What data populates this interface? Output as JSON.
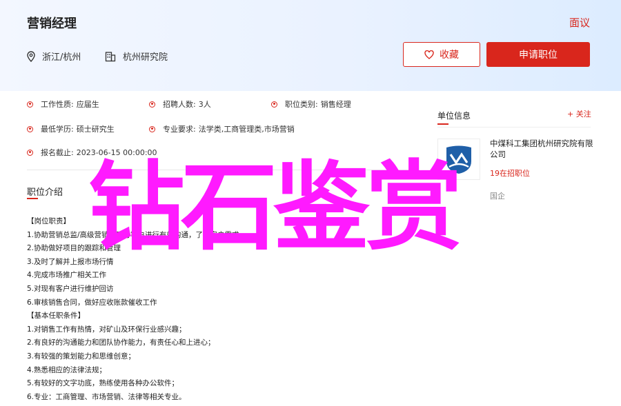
{
  "header": {
    "job_title": "营销经理",
    "negotiable": "面议",
    "location": "浙江/杭州",
    "organization": "杭州研究院",
    "favorite_label": "收藏",
    "apply_label": "申请职位"
  },
  "info": {
    "job_type_label": "工作性质:",
    "job_type_value": "应届生",
    "headcount_label": "招聘人数:",
    "headcount_value": "3人",
    "category_label": "职位类别:",
    "category_value": "销售经理",
    "education_label": "最低学历:",
    "education_value": "硕士研究生",
    "major_label": "专业要求:",
    "major_value": "法学类,工商管理类,市场营销",
    "deadline_label": "报名截止:",
    "deadline_value": "2023-06-15 00:00:00"
  },
  "intro": {
    "title": "职位介绍",
    "lines": [
      "【岗位职责】",
      "1.协助营销总监/高级营销经理与客户进行有效沟通，了解客户需求",
      "2.协助做好项目的跟踪和管理",
      "3.及时了解并上报市场行情",
      "4.完成市场推广相关工作",
      "5.对现有客户进行维护回访",
      "6.审核销售合同，做好应收账款催收工作",
      "【基本任职条件】",
      "1.对销售工作有热情，对矿山及环保行业感兴趣；",
      "2.有良好的沟通能力和团队协作能力，有责任心和上进心；",
      "3.有较强的策划能力和思维创意；",
      "4.熟悉相应的法律法规；",
      "5.有较好的文字功底，熟练使用各种办公软件；",
      "6.专业：工商管理、市场营销、法律等相关专业。"
    ]
  },
  "unit": {
    "title": "单位信息",
    "follow_label": "+ 关注",
    "company_name": "中煤科工集团杭州研究院有限公司",
    "stat": "19在招职位",
    "stat2": "国企"
  },
  "watermark": "钻石鉴赏",
  "colors": {
    "accent": "#d9261c",
    "watermark": "#ff1aff",
    "logo_blue": "#1f5fa8"
  }
}
